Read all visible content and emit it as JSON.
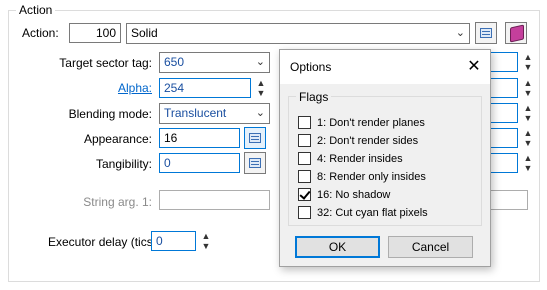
{
  "group": {
    "title": "Action"
  },
  "action": {
    "label": "Action:",
    "number": "100",
    "value": "Solid"
  },
  "fields": {
    "target_sector_tag": {
      "label": "Target sector tag:",
      "value": "650"
    },
    "alpha": {
      "label": "Alpha:",
      "value": "254"
    },
    "blending_mode": {
      "label": "Blending mode:",
      "value": "Translucent"
    },
    "appearance": {
      "label": "Appearance:",
      "value": "16"
    },
    "tangibility": {
      "label": "Tangibility:",
      "value": "0"
    },
    "string_arg_1": {
      "label": "String arg. 1:",
      "value": ""
    },
    "executor_delay": {
      "label": "Executor delay (tics):",
      "value": "0"
    }
  },
  "dialog": {
    "title": "Options",
    "close_glyph": "✕",
    "flags_title": "Flags",
    "flags": [
      {
        "label": "1: Don't render planes",
        "checked": false
      },
      {
        "label": "2: Don't render sides",
        "checked": false
      },
      {
        "label": "4: Render insides",
        "checked": false
      },
      {
        "label": "8: Render only insides",
        "checked": false
      },
      {
        "label": "16: No shadow",
        "checked": true
      },
      {
        "label": "32: Cut cyan flat pixels",
        "checked": false
      }
    ],
    "ok_label": "OK",
    "cancel_label": "Cancel"
  },
  "glyphs": {
    "dropdown": "⌄",
    "spin_up": "▲",
    "spin_down": "▼"
  },
  "icons": {
    "list": "list-icon",
    "book": "book-icon"
  },
  "colors": {
    "accent": "#0078d7",
    "link": "#0066cc",
    "book": "#c43f9c"
  }
}
